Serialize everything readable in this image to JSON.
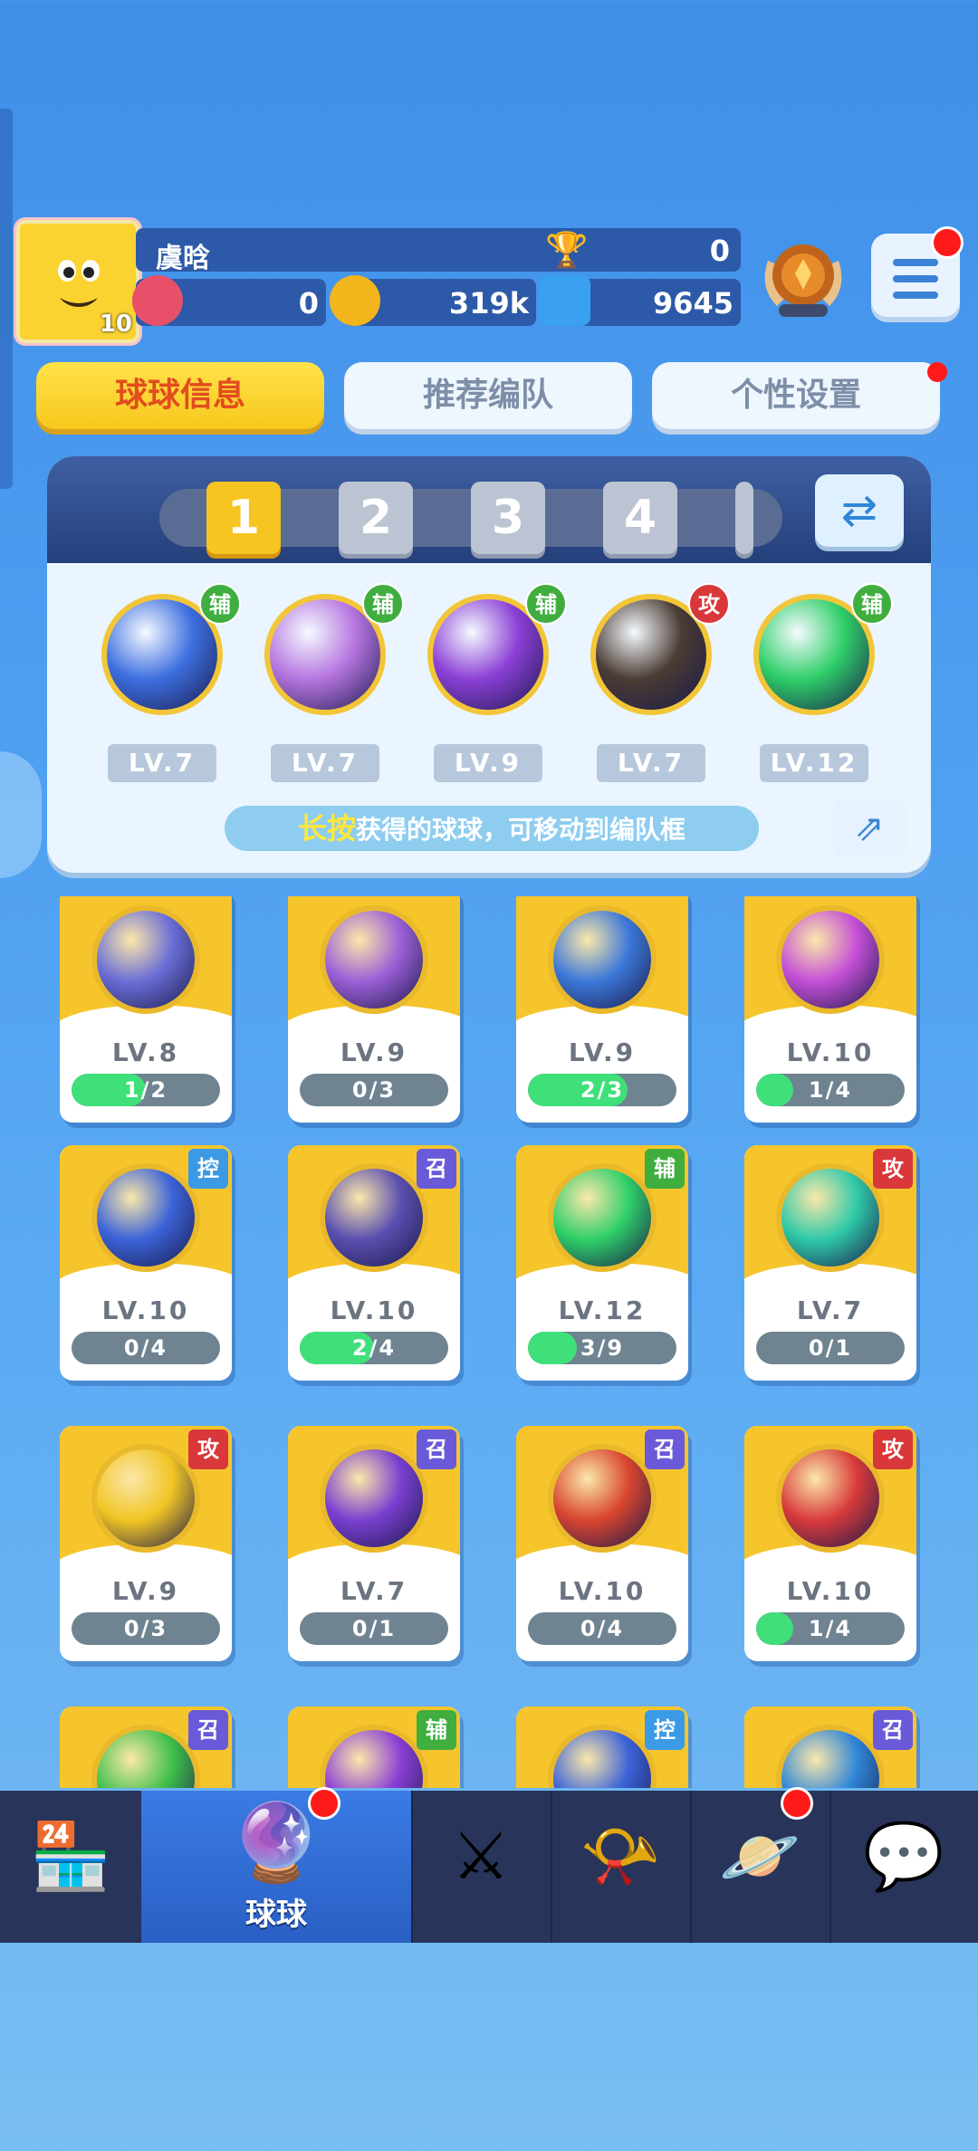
{
  "player": {
    "name": "虞晗",
    "avatar_level": "10",
    "trophies": "0",
    "tickets": "0",
    "coins": "319k",
    "gems": "9645"
  },
  "tabs": [
    {
      "label": "球球信息",
      "active": true
    },
    {
      "label": "推荐编队",
      "active": false
    },
    {
      "label": "个性设置",
      "active": false,
      "has_dot": true
    }
  ],
  "lineup": {
    "slots": [
      "1",
      "2",
      "3",
      "4"
    ],
    "active_slot": "1",
    "hint_highlight": "长按",
    "hint_text": "获得的球球，可移动到编队框",
    "balls": [
      {
        "level": "LV.7",
        "tag": "辅",
        "tag_color": "#3fae3f",
        "ball_color": "#3d6fe0",
        "icon": "hexagon-planet"
      },
      {
        "level": "LV.7",
        "tag": "辅",
        "tag_color": "#3fae3f",
        "ball_color": "#b675e0",
        "icon": "girl-portrait"
      },
      {
        "level": "LV.9",
        "tag": "辅",
        "tag_color": "#3fae3f",
        "ball_color": "#8b3fd6",
        "icon": "sprout"
      },
      {
        "level": "LV.7",
        "tag": "攻",
        "tag_color": "#d9383a",
        "ball_color": "#4a3b33",
        "icon": "boy-portrait"
      },
      {
        "level": "LV.12",
        "tag": "辅",
        "tag_color": "#3fae3f",
        "ball_color": "#2fcf69",
        "icon": "star-arrow"
      }
    ]
  },
  "cards": [
    {
      "level": "LV.8",
      "progress": "1/2",
      "fill": 0.5,
      "tag": "",
      "tag_color": "#d9383a",
      "ball_color": "#6a6ed6"
    },
    {
      "level": "LV.9",
      "progress": "0/3",
      "fill": 0,
      "tag": "",
      "tag_color": "#3fae3f",
      "ball_color": "#9b5fd6"
    },
    {
      "level": "LV.9",
      "progress": "2/3",
      "fill": 0.67,
      "tag": "",
      "tag_color": "#5a5fd6",
      "ball_color": "#3c78d8"
    },
    {
      "level": "LV.10",
      "progress": "1/4",
      "fill": 0.25,
      "tag": "",
      "tag_color": "#5a5fd6",
      "ball_color": "#c44fd6"
    },
    {
      "level": "LV.10",
      "progress": "0/4",
      "fill": 0,
      "tag": "控",
      "tag_color": "#3a9ae6",
      "ball_color": "#3b63d8"
    },
    {
      "level": "LV.10",
      "progress": "2/4",
      "fill": 0.5,
      "tag": "召",
      "tag_color": "#6a59d8",
      "ball_color": "#5a4fb0"
    },
    {
      "level": "LV.12",
      "progress": "3/9",
      "fill": 0.33,
      "tag": "辅",
      "tag_color": "#3fae3f",
      "ball_color": "#2fcf69"
    },
    {
      "level": "LV.7",
      "progress": "0/1",
      "fill": 0,
      "tag": "攻",
      "tag_color": "#d9383a",
      "ball_color": "#2fc9a8"
    },
    {
      "level": "LV.9",
      "progress": "0/3",
      "fill": 0,
      "tag": "攻",
      "tag_color": "#d9383a",
      "ball_color": "#f1c524"
    },
    {
      "level": "LV.7",
      "progress": "0/1",
      "fill": 0,
      "tag": "召",
      "tag_color": "#6a59d8",
      "ball_color": "#7a3fd0"
    },
    {
      "level": "LV.10",
      "progress": "0/4",
      "fill": 0,
      "tag": "召",
      "tag_color": "#6a59d8",
      "ball_color": "#d9452f"
    },
    {
      "level": "LV.10",
      "progress": "1/4",
      "fill": 0.25,
      "tag": "攻",
      "tag_color": "#d9383a",
      "ball_color": "#d83a3a"
    },
    {
      "level": "",
      "progress": "",
      "fill": 0,
      "tag": "召",
      "tag_color": "#6a59d8",
      "ball_color": "#3fc04a"
    },
    {
      "level": "",
      "progress": "",
      "fill": 0,
      "tag": "辅",
      "tag_color": "#3fae3f",
      "ball_color": "#8b3fd6"
    },
    {
      "level": "",
      "progress": "",
      "fill": 0,
      "tag": "控",
      "tag_color": "#3a9ae6",
      "ball_color": "#3b63d8"
    },
    {
      "level": "",
      "progress": "",
      "fill": 0,
      "tag": "召",
      "tag_color": "#6a59d8",
      "ball_color": "#2f86d8"
    }
  ],
  "nav": [
    {
      "label": "",
      "icon": "shop-icon",
      "glyph": "🏪",
      "active": false,
      "dot": false
    },
    {
      "label": "球球",
      "icon": "balls-icon",
      "glyph": "🔮",
      "active": true,
      "dot": true
    },
    {
      "label": "",
      "icon": "crossed-swords-icon",
      "glyph": "⚔",
      "active": false,
      "dot": false
    },
    {
      "label": "",
      "icon": "whistle-icon",
      "glyph": "📯",
      "active": false,
      "dot": false
    },
    {
      "label": "",
      "icon": "planet-icon",
      "glyph": "🪐",
      "active": false,
      "dot": true
    },
    {
      "label": "",
      "icon": "chat-phone-icon",
      "glyph": "💬",
      "active": false,
      "dot": false
    }
  ],
  "colors": {
    "accent_yellow": "#f6c521",
    "panel_blue": "#2c5aa8",
    "progress_green": "#3fe07a",
    "notification_red": "#ff1a1a"
  }
}
